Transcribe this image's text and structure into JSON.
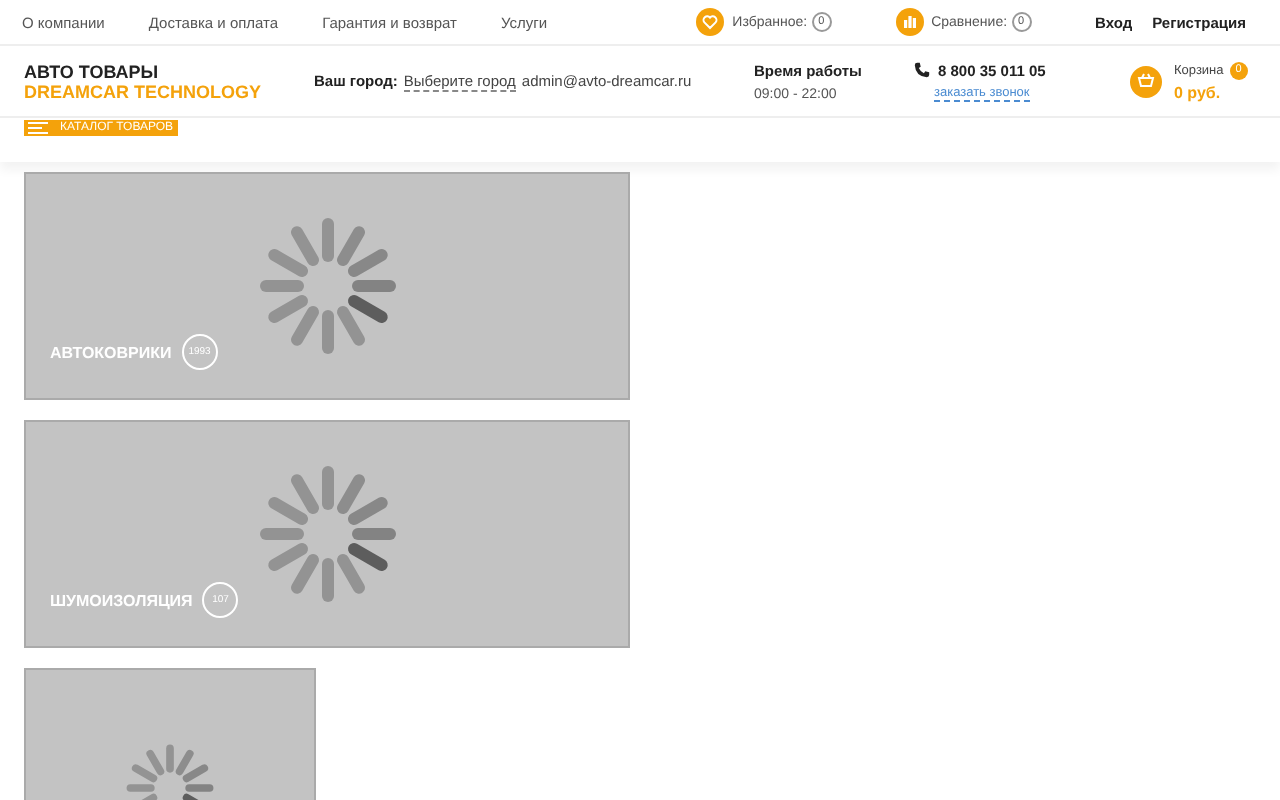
{
  "top_menu": [
    "О компании",
    "Доставка и оплата",
    "Гарантия и возврат",
    "Услуги"
  ],
  "favorites": {
    "label": "Избранное:",
    "count": "0"
  },
  "compare": {
    "label": "Сравнение:",
    "count": "0"
  },
  "auth": [
    "Вход",
    "Регистрация"
  ],
  "logo": {
    "line1": "АВТО ТОВАРЫ",
    "line2": "DREAMCAR TECHNOLOGY"
  },
  "city": {
    "label": "Ваш город:",
    "link": "Выберите город",
    "email": "admin@avto-dreamcar.ru"
  },
  "hours": {
    "title": "Время работы",
    "value": "09:00 - 22:00"
  },
  "phone": {
    "number": "8 800 35 011 05",
    "callback": "заказать звонок"
  },
  "cart": {
    "label": "Корзина",
    "count": "0",
    "total": "0 руб."
  },
  "catalog_button": "КАТАЛОГ ТОВАРОВ",
  "tiles": [
    {
      "kind": "wide",
      "title": "АВТОКОВРИКИ",
      "count": "1993"
    },
    {
      "kind": "wide",
      "title": "ШУМОИЗОЛЯЦИЯ",
      "count": "107"
    },
    {
      "kind": "narrow"
    }
  ]
}
